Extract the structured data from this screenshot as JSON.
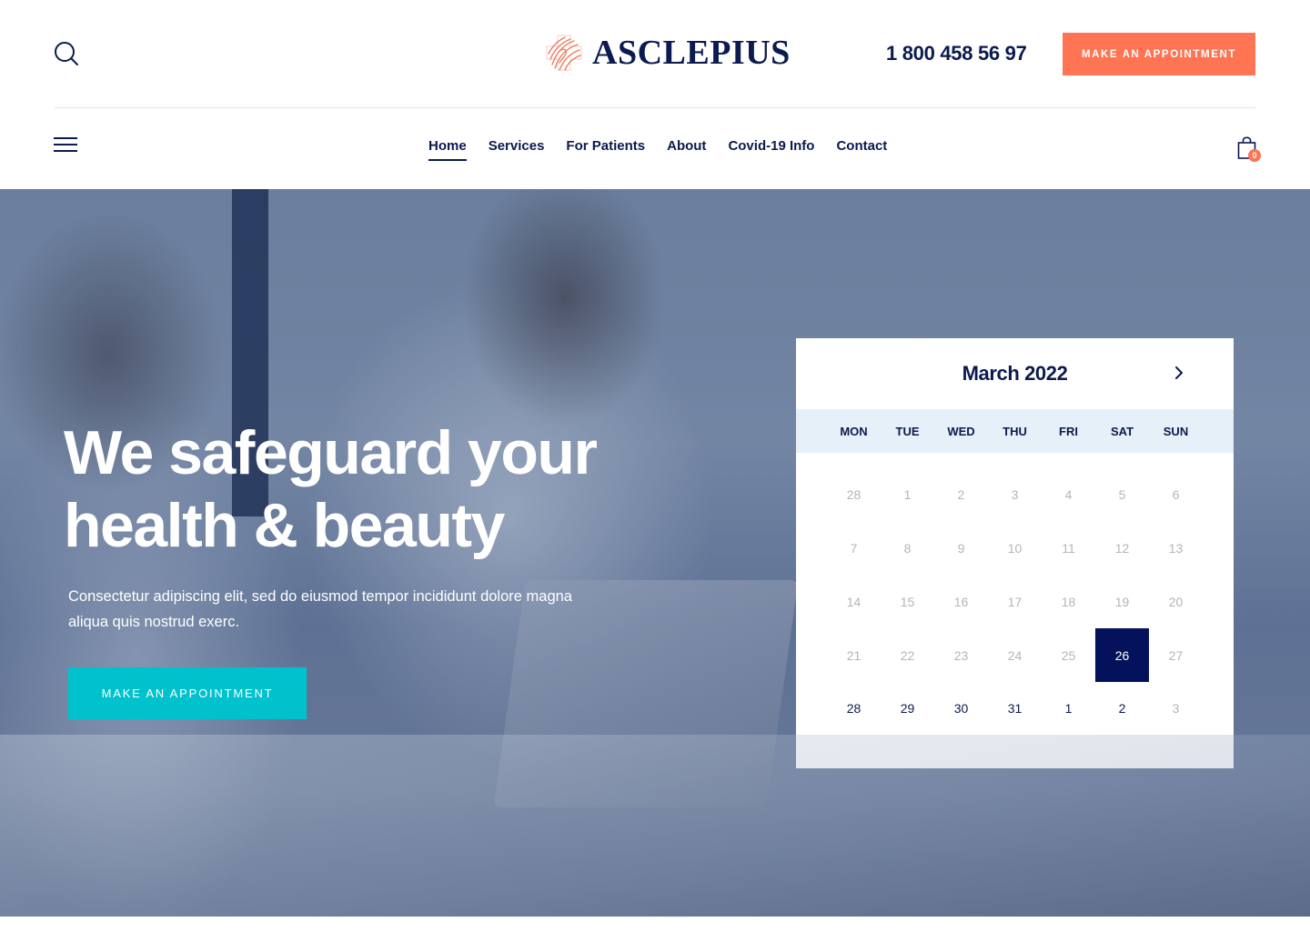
{
  "header": {
    "brand": "ASCLEPIUS",
    "phone": "1 800 458 56 97",
    "cta_label": "MAKE AN APPOINTMENT",
    "search_icon": "search-icon"
  },
  "nav": {
    "items": [
      {
        "label": "Home",
        "active": true
      },
      {
        "label": "Services",
        "active": false
      },
      {
        "label": "For Patients",
        "active": false
      },
      {
        "label": "About",
        "active": false
      },
      {
        "label": "Covid-19 Info",
        "active": false
      },
      {
        "label": "Contact",
        "active": false
      }
    ],
    "cart_count": "0"
  },
  "hero": {
    "title_line1": "We safeguard your",
    "title_line2": "health & beauty",
    "subtitle": "Consectetur adipiscing elit, sed do eiusmod tempor incididunt dolore magna aliqua quis nostrud exerc.",
    "cta_label": "MAKE AN APPOINTMENT"
  },
  "calendar": {
    "title": "March 2022",
    "weekdays": [
      "MON",
      "TUE",
      "WED",
      "THU",
      "FRI",
      "SAT",
      "SUN"
    ],
    "selected": "26",
    "weeks": [
      [
        {
          "d": "28",
          "s": "muted"
        },
        {
          "d": "1",
          "s": "muted"
        },
        {
          "d": "2",
          "s": "muted"
        },
        {
          "d": "3",
          "s": "muted"
        },
        {
          "d": "4",
          "s": "muted"
        },
        {
          "d": "5",
          "s": "muted"
        },
        {
          "d": "6",
          "s": "muted"
        }
      ],
      [
        {
          "d": "7",
          "s": "muted"
        },
        {
          "d": "8",
          "s": "muted"
        },
        {
          "d": "9",
          "s": "muted"
        },
        {
          "d": "10",
          "s": "muted"
        },
        {
          "d": "11",
          "s": "muted"
        },
        {
          "d": "12",
          "s": "muted"
        },
        {
          "d": "13",
          "s": "muted"
        }
      ],
      [
        {
          "d": "14",
          "s": "muted"
        },
        {
          "d": "15",
          "s": "muted"
        },
        {
          "d": "16",
          "s": "muted"
        },
        {
          "d": "17",
          "s": "muted"
        },
        {
          "d": "18",
          "s": "muted"
        },
        {
          "d": "19",
          "s": "muted"
        },
        {
          "d": "20",
          "s": "muted"
        }
      ],
      [
        {
          "d": "21",
          "s": "muted"
        },
        {
          "d": "22",
          "s": "muted"
        },
        {
          "d": "23",
          "s": "muted"
        },
        {
          "d": "24",
          "s": "muted"
        },
        {
          "d": "25",
          "s": "muted"
        },
        {
          "d": "26",
          "s": "selected"
        },
        {
          "d": "27",
          "s": "muted"
        }
      ],
      [
        {
          "d": "28",
          "s": "current"
        },
        {
          "d": "29",
          "s": "current"
        },
        {
          "d": "30",
          "s": "current"
        },
        {
          "d": "31",
          "s": "current"
        },
        {
          "d": "1",
          "s": "current"
        },
        {
          "d": "2",
          "s": "current"
        },
        {
          "d": "3",
          "s": "muted"
        }
      ]
    ]
  },
  "colors": {
    "navy": "#0b1a4f",
    "coral": "#ff7452",
    "teal": "#00c2cc",
    "selected_day": "#03125a",
    "weekday_bar": "#e6f0f8"
  }
}
